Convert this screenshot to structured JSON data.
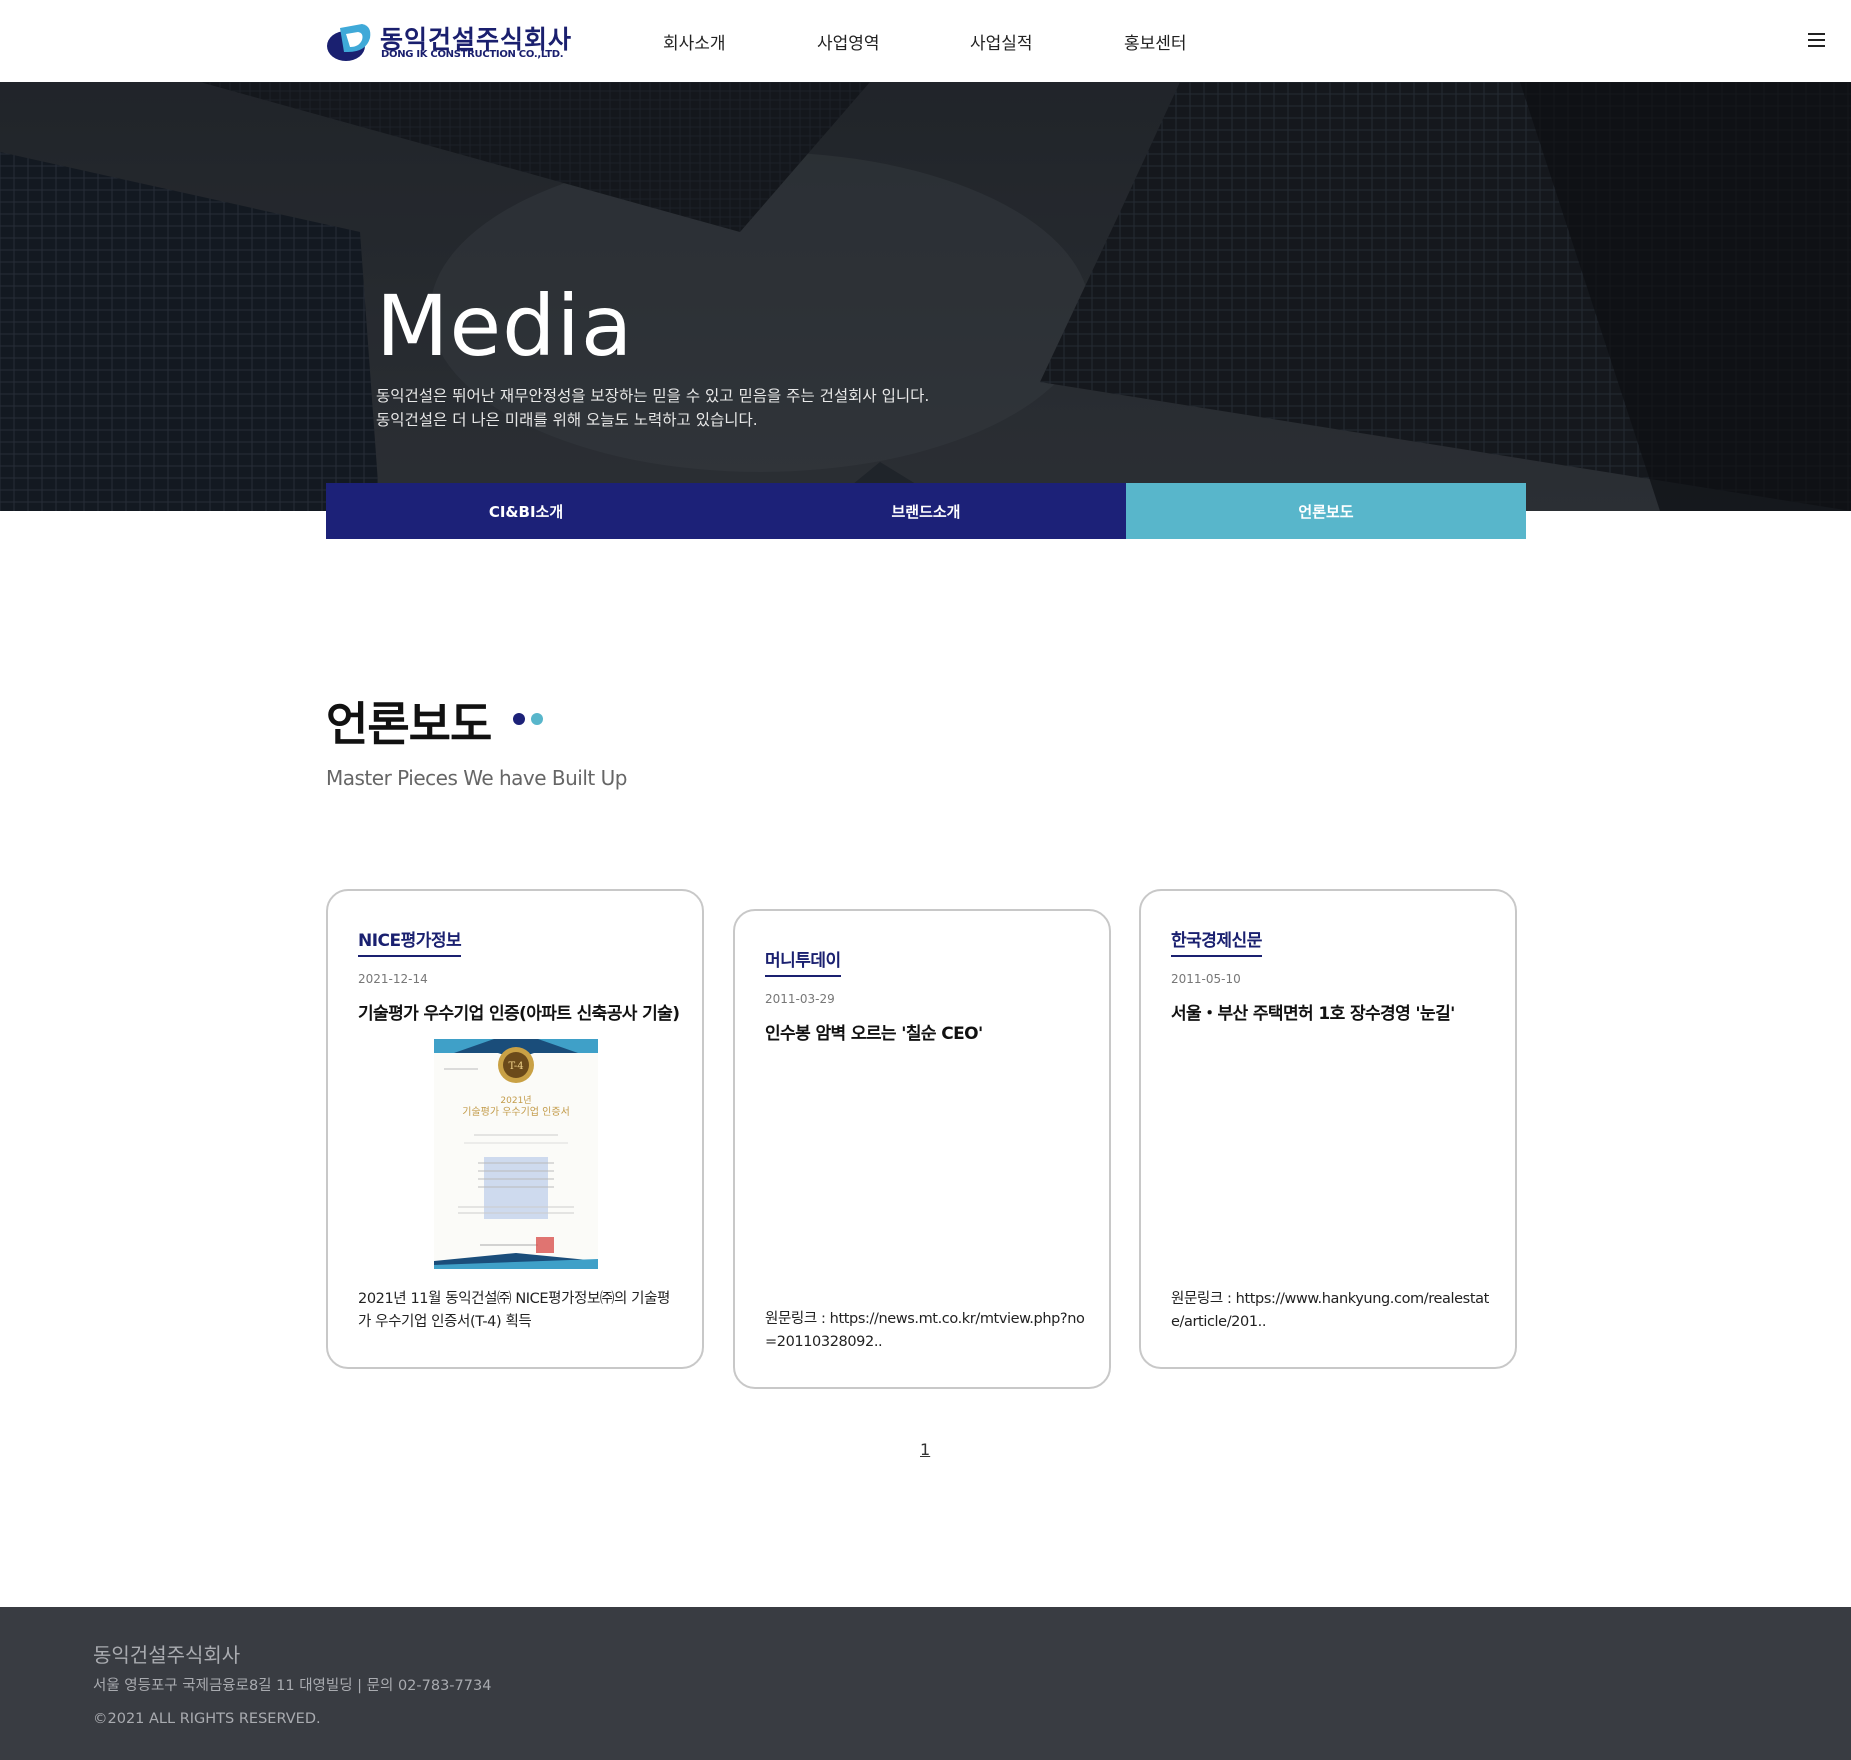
{
  "header": {
    "logo_ko": "동익건설주식회사",
    "logo_en": "DONG IK CONSTRUCTION CO.,LTD.",
    "nav": [
      "회사소개",
      "사업영역",
      "사업실적",
      "홍보센터"
    ]
  },
  "hero": {
    "title": "Media",
    "desc_line1": "동익건설은 뛰어난 재무안정성을 보장하는 믿을 수 있고 믿음을 주는 건설회사 입니다.",
    "desc_line2": "동익건설은 더 나은 미래를 위해 오늘도 노력하고 있습니다."
  },
  "tabs": [
    "CI&BI소개",
    "브랜드소개",
    "언론보도"
  ],
  "section": {
    "title": "언론보도",
    "subtitle": "Master Pieces We have Built Up"
  },
  "cards": [
    {
      "source": "NICE평가정보",
      "date": "2021-12-14",
      "title": "기술평가 우수기업 인증(아파트 신축공사 기술)",
      "body": "2021년 11월 동익건설㈜ NICE평가정보㈜의 기술평가 우수기업 인증서(T-4) 획득",
      "cert_year": "2021년",
      "cert_title": "기술평가 우수기업 인증서",
      "cert_badge": "T-4"
    },
    {
      "source": "머니투데이",
      "date": "2011-03-29",
      "title": "인수봉 암벽 오르는 '칠순 CEO'",
      "body": "원문링크 : https://news.mt.co.kr/mtview.php?no=20110328092.."
    },
    {
      "source": "한국경제신문",
      "date": "2011-05-10",
      "title": "서울・부산 주택면허 1호 장수경영 '눈길'",
      "body": "원문링크 : https://www.hankyung.com/realestate/article/201.."
    }
  ],
  "pagination": {
    "current": "1"
  },
  "footer": {
    "company": "동익건설주식회사",
    "address": "서울 영등포구 국제금융로8길 11 대영빌딩   |   문의 02-783-7734",
    "copyright": "©2021 ALL RIGHTS RESERVED."
  },
  "colors": {
    "navy": "#1c2178",
    "teal": "#58b6cb",
    "footer_bg": "#393c42"
  }
}
